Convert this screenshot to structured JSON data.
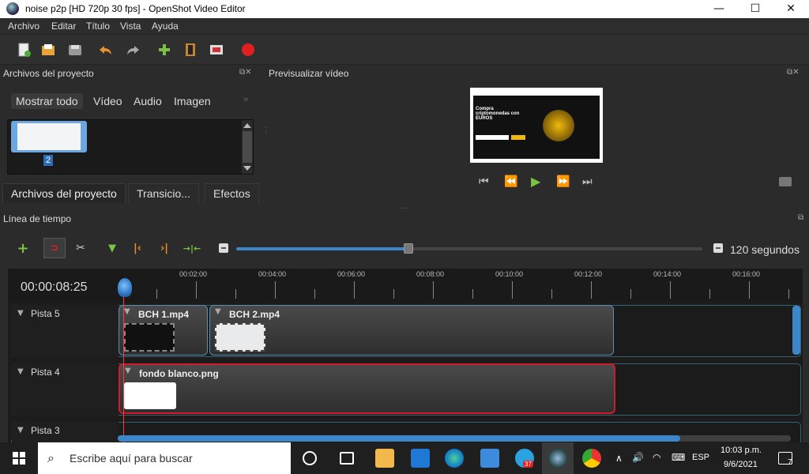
{
  "window": {
    "title": "noise p2p [HD 720p 30 fps] - OpenShot Video Editor",
    "controls": [
      "—",
      "☐",
      "✕"
    ]
  },
  "menubar": [
    "Archivo",
    "Editar",
    "Título",
    "Vista",
    "Ayuda"
  ],
  "project_files": {
    "title": "Archivos del proyecto",
    "filter_tabs": [
      "Mostrar todo",
      "Vídeo",
      "Audio",
      "Imagen"
    ],
    "more": "»",
    "item_number": "2",
    "bottom_tabs": [
      "Archivos del proyecto",
      "Transicio...",
      "Efectos"
    ]
  },
  "preview": {
    "title": "Previsualizar vídeo",
    "screen_heading": "Compra criptomonedas con EUROS",
    "controls": [
      "⏮",
      "⏪",
      "▶",
      "⏩",
      "⏭"
    ]
  },
  "timeline": {
    "title": "Línea de tiempo",
    "zoom_value": 0.37,
    "zoom_label": "120 segundos",
    "timecode": "00:00:08:25",
    "ruler_ticks": [
      "00:02:00",
      "00:04:00",
      "00:06:00",
      "00:08:00",
      "00:10:00",
      "00:12:00",
      "00:14:00",
      "00:16:00"
    ],
    "tracks": [
      {
        "name": "Pista 5",
        "clips": [
          "BCH 1.mp4",
          "BCH 2.mp4"
        ]
      },
      {
        "name": "Pista 4",
        "clips": [
          "fondo blanco.png"
        ]
      },
      {
        "name": "Pista 3",
        "clips": []
      }
    ]
  },
  "taskbar": {
    "search_placeholder": "Escribe aquí para buscar",
    "telegram_badge": "37",
    "lang": "ESP",
    "time": "10:03 p.m.",
    "date": "9/6/2021",
    "notifications": "7"
  },
  "colors": {
    "accent": "#3b87c9",
    "playhead": "#ff3b3b",
    "selected_clip_border": "#d11a2a"
  }
}
